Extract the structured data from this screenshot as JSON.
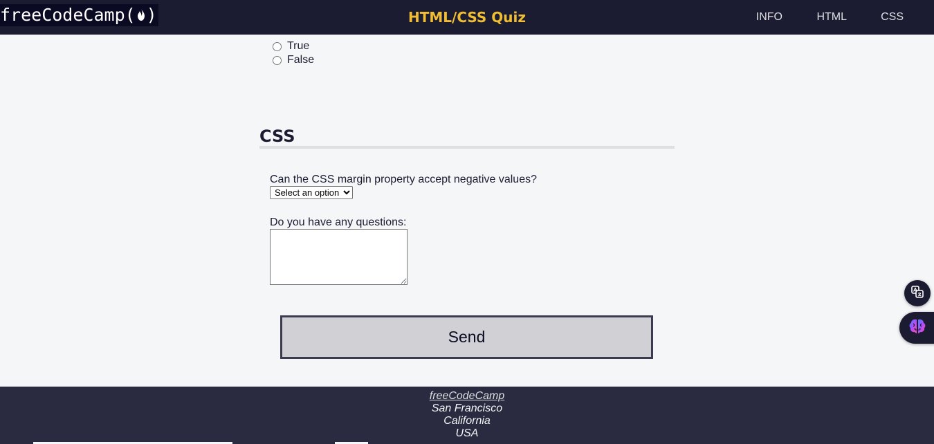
{
  "header": {
    "logo_text": "freeCodeCamp(",
    "logo_close": ")",
    "title": "HTML/CSS Quiz",
    "nav": [
      "INFO",
      "HTML",
      "CSS"
    ]
  },
  "radios": [
    "True",
    "False"
  ],
  "css_section": {
    "heading": "CSS",
    "question": "Can the CSS margin property accept negative values?",
    "select_value": "Select an option",
    "questions_label": "Do you have any questions:",
    "send_label": "Send"
  },
  "footer": {
    "link": "freeCodeCamp",
    "city": "San Francisco",
    "state": "California",
    "country": "USA"
  },
  "colors": {
    "header_bg": "#1b1b32",
    "accent": "#f1be32",
    "page_bg": "#f5f6f7",
    "footer_bg": "#2a2a40",
    "button_bg": "#d0d0d5"
  },
  "icons": [
    "flame-icon",
    "translate-icon",
    "brain-icon"
  ]
}
